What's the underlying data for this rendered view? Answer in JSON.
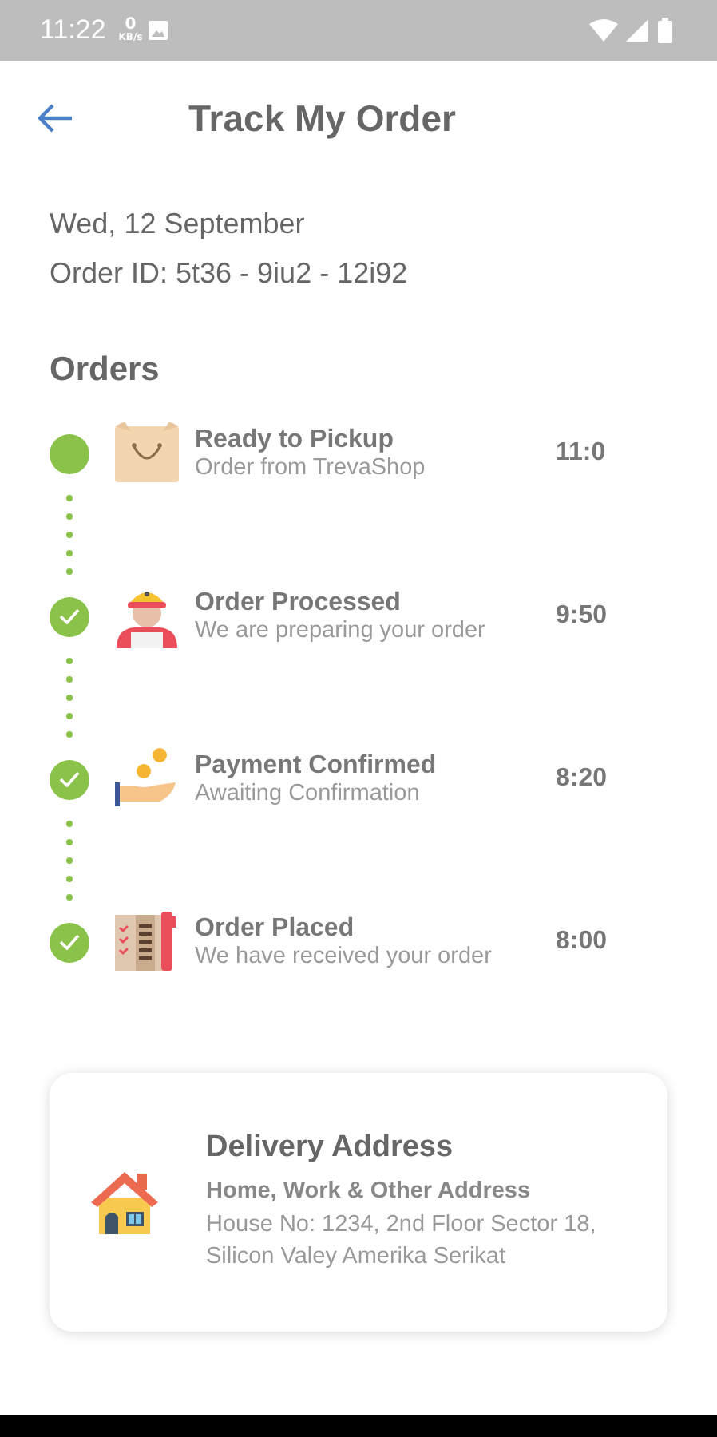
{
  "status_bar": {
    "time": "11:22",
    "speed_value": "0",
    "speed_unit": "KB/s"
  },
  "header": {
    "title": "Track My Order"
  },
  "order": {
    "date": "Wed, 12 September",
    "order_id": "Order ID: 5t36 - 9iu2 - 12i92"
  },
  "orders_heading": "Orders",
  "steps": [
    {
      "kind": "box",
      "title": "Ready to Pickup",
      "subtitle": "Order from TrevaShop",
      "time": "11:0",
      "checked": false
    },
    {
      "kind": "worker",
      "title": "Order Processed",
      "subtitle": "We are preparing your order",
      "time": "9:50",
      "checked": true
    },
    {
      "kind": "payment",
      "title": "Payment Confirmed",
      "subtitle": "Awaiting Confirmation",
      "time": "8:20",
      "checked": true
    },
    {
      "kind": "list",
      "title": "Order Placed",
      "subtitle": "We have received your order",
      "time": "8:00",
      "checked": true
    }
  ],
  "delivery": {
    "title": "Delivery Address",
    "subtitle": "Home, Work & Other Address",
    "address": "House No: 1234, 2nd Floor Sector 18, Silicon Valey Amerika Serikat"
  }
}
